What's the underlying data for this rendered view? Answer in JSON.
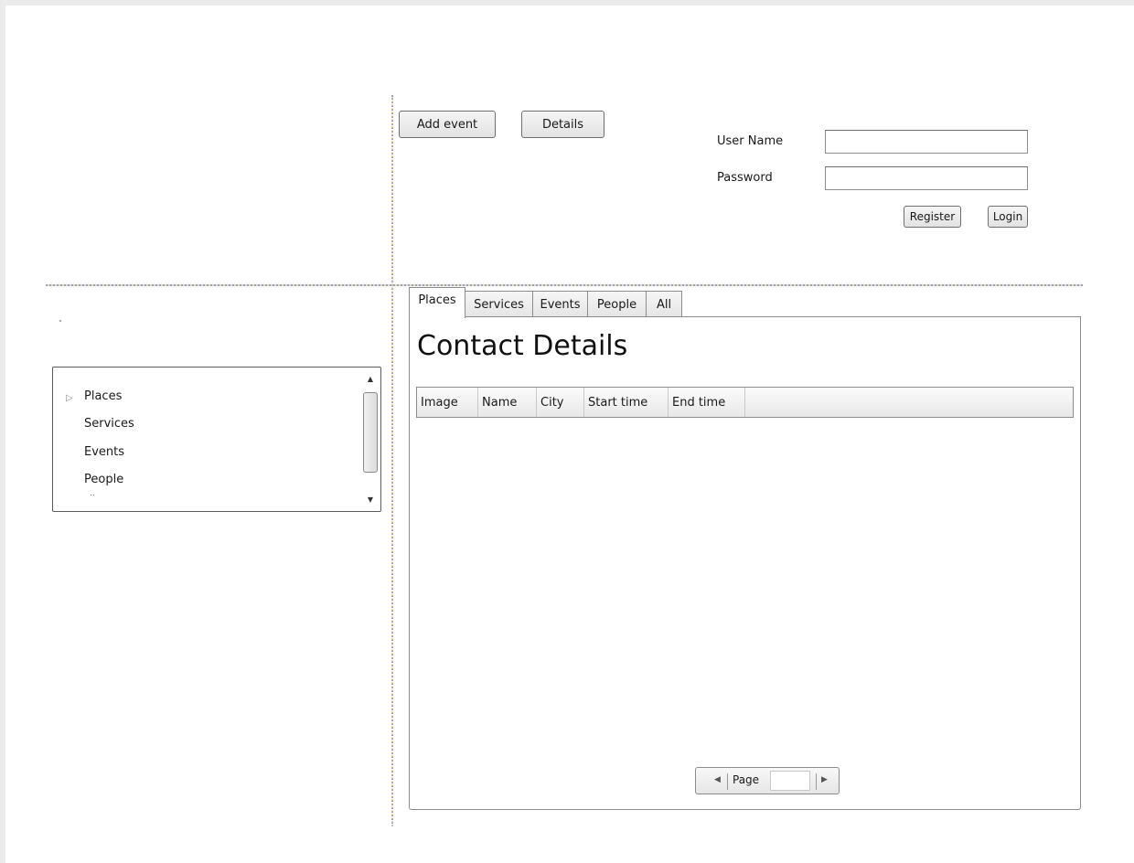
{
  "toolbar": {
    "add_event_label": "Add event",
    "details_label": "Details"
  },
  "login": {
    "username_label": "User Name",
    "username_value": "",
    "password_label": "Password",
    "password_value": "",
    "register_label": "Register",
    "login_label": "Login"
  },
  "tree": {
    "items": [
      {
        "label": "Places",
        "expand_icon": "triangle-right-icon"
      },
      {
        "label": "Services"
      },
      {
        "label": "Events"
      },
      {
        "label": "People"
      }
    ],
    "overflow_text": ".."
  },
  "tabs": [
    {
      "label": "Places",
      "active": true
    },
    {
      "label": "Services"
    },
    {
      "label": "Events"
    },
    {
      "label": "People"
    },
    {
      "label": "All"
    }
  ],
  "panel": {
    "title": "Contact Details",
    "columns": [
      "Image",
      "Name",
      "City",
      "Start time",
      "End time"
    ]
  },
  "pager": {
    "label": "Page",
    "value": ""
  },
  "colors": {
    "splitter_blue": "#9a9ae6",
    "splitter_yellow": "#e6d36a",
    "page_bg": "#ebebeb"
  }
}
